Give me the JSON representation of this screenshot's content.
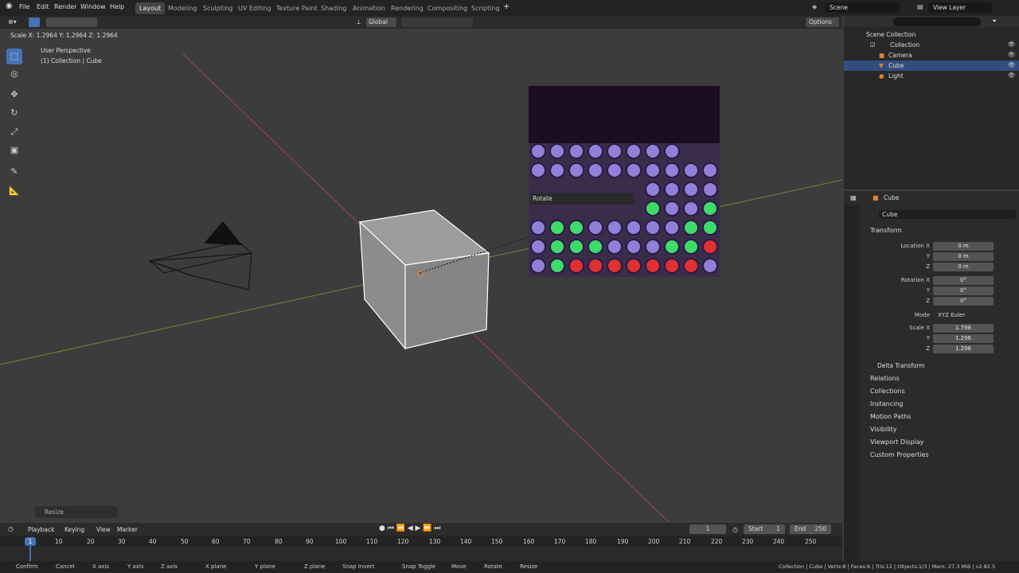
{
  "menubar": {
    "items": [
      "File",
      "Edit",
      "Render",
      "Window",
      "Help"
    ],
    "workspaces": [
      "Layout",
      "Modeling",
      "Sculpting",
      "UV Editing",
      "Texture Paint",
      "Shading",
      "Animation",
      "Rendering",
      "Compositing",
      "Scripting"
    ],
    "add_tab": "+",
    "scene_label": "Scene",
    "view_layer_label": "View Layer"
  },
  "viewport_header": {
    "status": "Scale X: 1.2964   Y: 1.2964   Z: 1.2964",
    "orientation": "Global",
    "options": "Options"
  },
  "viewport": {
    "view_name": "User Perspective",
    "collection_info": "(1) Collection | Cube",
    "last_op": "Resize",
    "tooltip": "Rotate"
  },
  "outliner": {
    "root": "Scene Collection",
    "collection": "Collection",
    "items": [
      "Camera",
      "Cube",
      "Light"
    ]
  },
  "properties": {
    "object_name": "Cube",
    "object_field": "Cube",
    "transform_label": "Transform",
    "location_label": "Location X",
    "rotation_label": "Rotation X",
    "scale_label": "Scale X",
    "y_label": "Y",
    "z_label": "Z",
    "location": [
      "0 m",
      "0 m",
      "0 m"
    ],
    "rotation": [
      "0°",
      "0°",
      "0°"
    ],
    "scale": [
      "1.798",
      "1.296",
      "1.296"
    ],
    "mode_label": "Mode",
    "mode_value": "XYZ Euler",
    "delta": "Delta Transform",
    "sections": [
      "Relations",
      "Collections",
      "Instancing",
      "Motion Paths",
      "Visibility",
      "Viewport Display",
      "Custom Properties"
    ]
  },
  "timeline": {
    "menu": [
      "Playback",
      "Keying",
      "View",
      "Marker"
    ],
    "current_frame": "1",
    "start_label": "Start",
    "start": "1",
    "end_label": "End",
    "end": "250",
    "ticks": [
      "10",
      "20",
      "30",
      "40",
      "50",
      "60",
      "70",
      "80",
      "90",
      "100",
      "110",
      "120",
      "130",
      "140",
      "150",
      "160",
      "170",
      "180",
      "190",
      "200",
      "210",
      "220",
      "230",
      "240",
      "250"
    ],
    "playhead": "1"
  },
  "statusbar": {
    "items": [
      "Confirm",
      "Cancel",
      "X axis",
      "Y axis",
      "Z axis",
      "X plane",
      "Y plane",
      "Z plane",
      "Snap Invert",
      "Snap Toggle",
      "Move",
      "Rotate",
      "Resize"
    ],
    "right": "Collection | Cube | Verts:8 | Faces:6 | Tris:12 | Objects:1/3 | Mem: 27.3 MiB | v2.82.5"
  },
  "colors": {
    "accent": "#4772b3",
    "selected_row": "#334d80",
    "popup_bg": "#1d0d21",
    "icon_purple": "#8f80d8",
    "icon_green": "#3ddc6a",
    "icon_red": "#e03030"
  }
}
